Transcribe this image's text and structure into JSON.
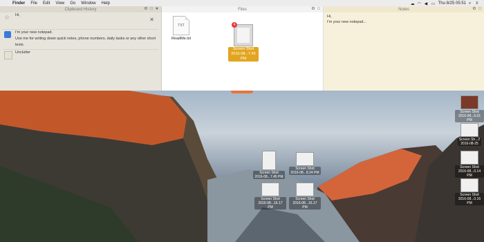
{
  "menubar": {
    "apple": "",
    "items": [
      "Finder",
      "File",
      "Edit",
      "View",
      "Go",
      "Window",
      "Help"
    ],
    "clock": "Thu 8/25 05:51"
  },
  "clipboard_panel": {
    "title": "Clipboard History",
    "items": [
      {
        "text": "Hi,"
      },
      {
        "text": "I'm your new notepad."
      },
      {
        "text": "Use me for writing down quick notes, phone numbers, daily tasks or any other short texts."
      },
      {
        "text": "Unclutter"
      }
    ]
  },
  "files_panel": {
    "title": "Files",
    "files": [
      {
        "name": "ReadMe.txt",
        "type_label": "TXT"
      },
      {
        "name_line1": "Screen Shot",
        "name_line2": "2016-08...7.45 PM",
        "badge": "4"
      }
    ]
  },
  "notes_panel": {
    "title": "Notes",
    "lines": [
      "Hi,",
      "I'm your new notepad..."
    ]
  },
  "desktop_icons": {
    "right": [
      {
        "line1": "Screen Shot",
        "line2": "2016-08...6.01 PM"
      },
      {
        "line1": "Screen Sh...2",
        "line2": "2016-08-25"
      },
      {
        "line1": "Screen Shot",
        "line2": "2016-08...0.14 PM"
      },
      {
        "line1": "Screen Shot",
        "line2": "2016-08...0.16 PM"
      }
    ],
    "center": [
      {
        "line1": "Screen Shot",
        "line2": "2016-08...7.45 PM"
      },
      {
        "line1": "Screen Shot",
        "line2": "2016-08...8.24 PM"
      },
      {
        "line1": "Screen Shot",
        "line2": "2016-08...16.17 PM"
      },
      {
        "line1": "Screen Shot",
        "line2": "2016-08...16.17 PM"
      }
    ]
  }
}
